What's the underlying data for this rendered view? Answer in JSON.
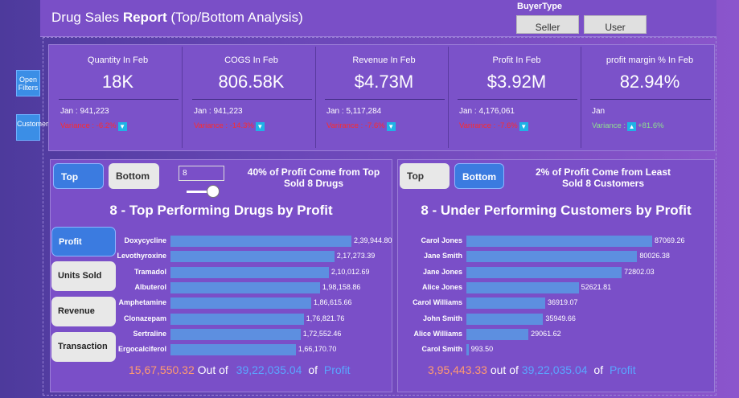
{
  "header": {
    "title_prefix": "Drug Sales ",
    "title_bold": "Report",
    "title_suffix": " (Top/Bottom Analysis)",
    "buyertype_label": "BuyerType",
    "buyer_options": [
      "Seller",
      "User"
    ]
  },
  "side_buttons": [
    {
      "label": "Open Filters",
      "icon": "filter-panel-button"
    },
    {
      "label": "Customer",
      "icon": "customer-panel-button"
    }
  ],
  "kpis": [
    {
      "label": "Quantity In Feb",
      "value": "18K",
      "jan": "Jan : 941,223",
      "variance": "Variance : -6.2%",
      "direction": "down"
    },
    {
      "label": "COGS In Feb",
      "value": "806.58K",
      "jan": "Jan : 941,223",
      "variance": "Variance : -14.3%",
      "direction": "down"
    },
    {
      "label": "Revenue In Feb",
      "value": "$4.73M",
      "jan": "Jan : 5,117,284",
      "variance": "Varirance : -7.6%",
      "direction": "down"
    },
    {
      "label": "Profit In Feb",
      "value": "$3.92M",
      "jan": "Jan : 4,176,061",
      "variance": "Varirance : -7.6%",
      "direction": "down"
    },
    {
      "label": "profit margin % In Feb",
      "value": "82.94%",
      "jan": "Jan",
      "variance_label": "Variance :",
      "variance_value": "+81.6%",
      "direction": "up"
    }
  ],
  "left_panel": {
    "top_label": "Top",
    "bottom_label": "Bottom",
    "n_value": "8",
    "note": "40% of Profit Come from Top Sold 8 Drugs",
    "title": "8 - Top Performing Drugs by Profit",
    "metrics": [
      "Profit",
      "Units Sold",
      "Revenue",
      "Transaction"
    ],
    "active_metric": "Profit",
    "footer": {
      "amount": "15,67,550.32",
      "out_of": "Out of",
      "total": "39,22,035.04",
      "of": "of",
      "measure": "Profit"
    }
  },
  "right_panel": {
    "top_label": "Top",
    "bottom_label": "Bottom",
    "note": "2% of Profit Come from Least Sold 8 Customers",
    "title": "8 - Under Performing Customers by Profit",
    "footer": {
      "amount": "3,95,443.33",
      "out_of": "out of",
      "total": "39,22,035.04",
      "of": "of",
      "measure": "Profit"
    }
  },
  "chart_data": [
    {
      "type": "bar",
      "title": "8 - Top Performing Drugs by Profit",
      "orientation": "horizontal",
      "categories": [
        "Doxycycline",
        "Levothyroxine",
        "Tramadol",
        "Albuterol",
        "Amphetamine",
        "Clonazepam",
        "Sertraline",
        "Ergocalciferol"
      ],
      "values": [
        239944.8,
        217273.39,
        210012.69,
        198158.86,
        186615.66,
        176821.76,
        172552.46,
        166170.7
      ],
      "labels": [
        "2,39,944.80",
        "2,17,273.39",
        "2,10,012.69",
        "1,98,158.86",
        "1,86,615.66",
        "1,76,821.76",
        "1,72,552.46",
        "1,66,170.70"
      ]
    },
    {
      "type": "bar",
      "title": "8 - Under Performing Customers by Profit",
      "orientation": "horizontal",
      "categories": [
        "Carol Jones",
        "Jane Smith",
        "Jane Jones",
        "Alice Jones",
        "Carol Williams",
        "John Smith",
        "Alice Williams",
        "Carol Smith"
      ],
      "values": [
        87069.26,
        80026.38,
        72802.03,
        52621.81,
        36919.07,
        35949.66,
        29061.62,
        993.5
      ],
      "labels": [
        "87069.26",
        "80026.38",
        "72802.03",
        "52621.81",
        "36919.07",
        "35949.66",
        "29061.62",
        "993.50"
      ]
    }
  ],
  "colors": {
    "bar": "#5d8fe0",
    "negative": "#ff2b2b",
    "positive": "#8fe08f",
    "accent": "#3b7be0"
  }
}
